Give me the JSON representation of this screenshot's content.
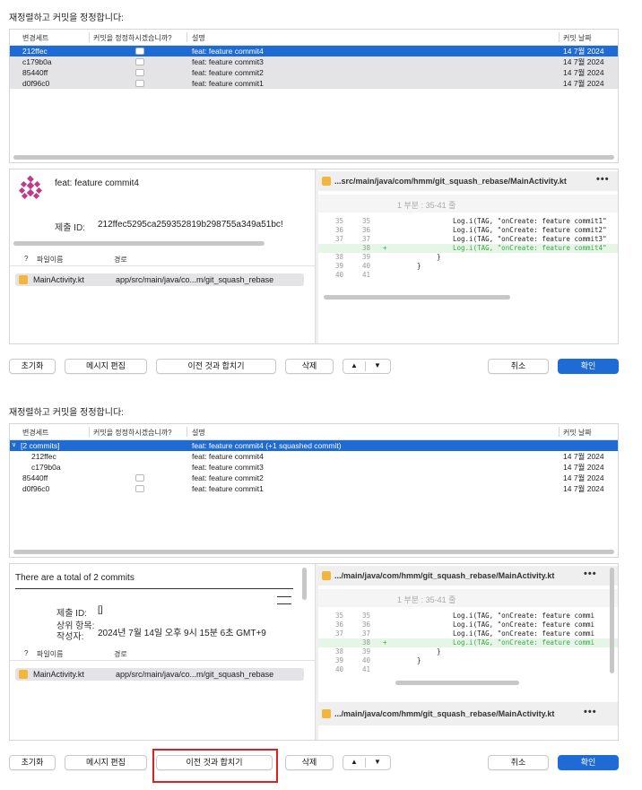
{
  "colors": {
    "accent": "#1f6bd6",
    "highlight_box": "#e02020",
    "diff_added": "#3aa64a",
    "file_icon": "#f4b63a"
  },
  "panel1": {
    "heading": "재정렬하고 커밋을 정정합니다:",
    "columns": [
      "변경세트",
      "커밋을 정정하시겠습니까?",
      "설명",
      "커밋 날짜"
    ],
    "rows": [
      {
        "hash": "212ffec",
        "desc": "feat: feature commit4",
        "date": "14 7월 2024"
      },
      {
        "hash": "c179b0a",
        "desc": "feat: feature commit3",
        "date": "14 7월 2024"
      },
      {
        "hash": "85440ff",
        "desc": "feat: feature commit2",
        "date": "14 7월 2024"
      },
      {
        "hash": "d0f96c0",
        "desc": "feat: feature commit1",
        "date": "14 7월 2024"
      }
    ],
    "detail": {
      "message": "feat: feature commit4",
      "submit_id_label": "제출 ID:",
      "submit_id_value": "212ffec5295ca259352819b298755a349a51bc!",
      "file_columns": [
        "?",
        "파일이름",
        "경로"
      ],
      "file": {
        "name": "MainActivity.kt",
        "path": "app/src/main/java/co...m/git_squash_rebase"
      }
    },
    "diff": {
      "path": "...src/main/java/com/hmm/git_squash_rebase/MainActivity.kt",
      "more": "•••",
      "hunk": "1 부분 : 35-41 줄",
      "lines": [
        {
          "a": "35",
          "b": "35",
          "mark": "",
          "text": "Log.i(TAG, \"onCreate: feature commit1\"",
          "added": false
        },
        {
          "a": "36",
          "b": "36",
          "mark": "",
          "text": "Log.i(TAG, \"onCreate: feature commit2\"",
          "added": false
        },
        {
          "a": "37",
          "b": "37",
          "mark": "",
          "text": "Log.i(TAG, \"onCreate: feature commit3\"",
          "added": false
        },
        {
          "a": "",
          "b": "38",
          "mark": "+",
          "text": "Log.i(TAG, \"onCreate: feature commit4\"",
          "added": true
        },
        {
          "a": "38",
          "b": "39",
          "mark": "",
          "text": "}",
          "added": false
        },
        {
          "a": "39",
          "b": "40",
          "mark": "",
          "text": "}",
          "added": false
        },
        {
          "a": "40",
          "b": "41",
          "mark": "",
          "text": "",
          "added": false
        }
      ]
    },
    "buttons": {
      "reset": "초기화",
      "edit_message": "메시지 편집",
      "squash": "이전 것과 합치기",
      "delete": "삭제",
      "up": "▲",
      "down": "▼",
      "cancel": "취소",
      "confirm": "확인"
    }
  },
  "panel2": {
    "heading": "재정렬하고 커밋을 정정합니다:",
    "columns": [
      "변경세트",
      "커밋을 정정하시겠습니까?",
      "설명",
      "커밋 날짜"
    ],
    "group": {
      "hash": "[2 commits]",
      "desc": "feat: feature commit4 (+1 squashed commit)"
    },
    "rows": [
      {
        "hash": "212ffec",
        "desc": "feat: feature commit4",
        "date": "14 7월 2024",
        "indent": true
      },
      {
        "hash": "c179b0a",
        "desc": "feat: feature commit3",
        "date": "14 7월 2024",
        "indent": true
      },
      {
        "hash": "85440ff",
        "desc": "feat: feature commit2",
        "date": "14 7월 2024",
        "indent": false
      },
      {
        "hash": "d0f96c0",
        "desc": "feat: feature commit1",
        "date": "14 7월 2024",
        "indent": false
      }
    ],
    "detail": {
      "message": "There are a total of 2 commits",
      "submit_id_label": "제출 ID:",
      "submit_id_value": "[]",
      "parent_label": "상위 항목:",
      "author_label": "작성자:",
      "author_value": "2024년 7월 14일 오후 9시 15분 6초 GMT+9",
      "file_columns": [
        "?",
        "파일이름",
        "경로"
      ],
      "file": {
        "name": "MainActivity.kt",
        "path": "app/src/main/java/co...m/git_squash_rebase"
      }
    },
    "diff": {
      "path": ".../main/java/com/hmm/git_squash_rebase/MainActivity.kt",
      "path2": ".../main/java/com/hmm/git_squash_rebase/MainActivity.kt",
      "more": "•••",
      "hunk": "1 부분 : 35-41 줄",
      "lines": [
        {
          "a": "35",
          "b": "35",
          "mark": "",
          "text": "Log.i(TAG, \"onCreate: feature commi",
          "added": false
        },
        {
          "a": "36",
          "b": "36",
          "mark": "",
          "text": "Log.i(TAG, \"onCreate: feature commi",
          "added": false
        },
        {
          "a": "37",
          "b": "37",
          "mark": "",
          "text": "Log.i(TAG, \"onCreate: feature commi",
          "added": false
        },
        {
          "a": "",
          "b": "38",
          "mark": "+",
          "text": "Log.i(TAG, \"onCreate: feature commi",
          "added": true
        },
        {
          "a": "38",
          "b": "39",
          "mark": "",
          "text": "}",
          "added": false
        },
        {
          "a": "39",
          "b": "40",
          "mark": "",
          "text": "}",
          "added": false
        },
        {
          "a": "40",
          "b": "41",
          "mark": "",
          "text": "",
          "added": false
        }
      ]
    },
    "buttons": {
      "reset": "초기화",
      "edit_message": "메시지 편집",
      "squash": "이전 것과 합치기",
      "delete": "삭제",
      "up": "▲",
      "down": "▼",
      "cancel": "취소",
      "confirm": "확인"
    }
  }
}
